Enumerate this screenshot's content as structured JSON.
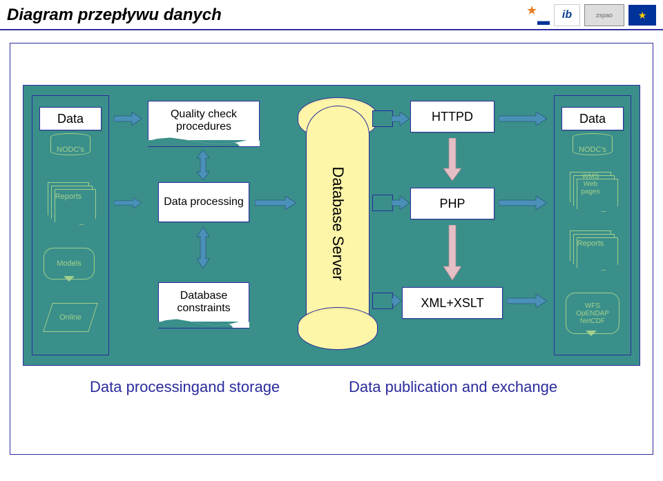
{
  "header": {
    "title": "Diagram przepływu danych"
  },
  "logos": {
    "star": "star-logo",
    "ib": "ib",
    "zsp": "zspao",
    "eu": "★"
  },
  "left_col": {
    "data_label": "Data",
    "nodcs": "NODC's",
    "reports": "Reports",
    "models": "Models",
    "online": "Online"
  },
  "mid": {
    "quality": "Quality check procedures",
    "processing": "Data processing",
    "constraints": "Database constraints",
    "dbserver": "Database Server"
  },
  "right_mid": {
    "httpd": "HTTPD",
    "php": "PHP",
    "xml": "XML+XSLT"
  },
  "right_col": {
    "data_label": "Data",
    "nodcs": "NODC's",
    "wms": "WMS\nWeb pages",
    "reports": "Reports",
    "wfs": "WFS\nOpENDAP\nNetCDF"
  },
  "captions": {
    "left": "Data processingand storage",
    "right": "Data publication and exchange"
  }
}
